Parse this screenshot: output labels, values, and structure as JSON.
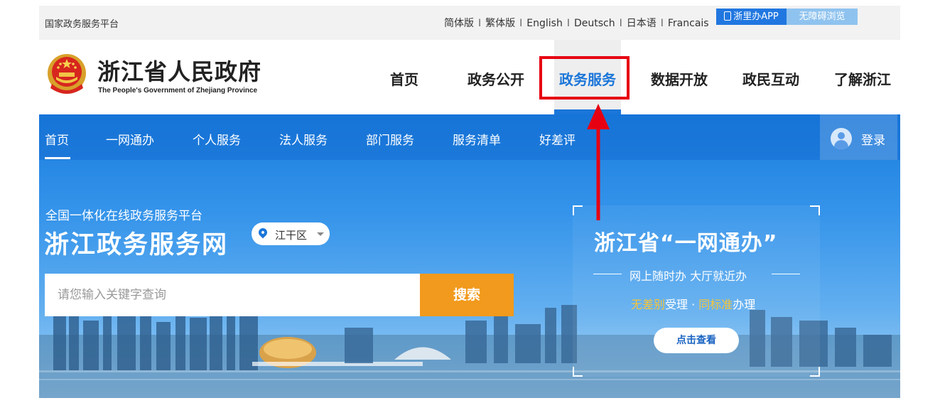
{
  "topbar": {
    "platform": "国家政务服务平台",
    "languages": [
      "简体版",
      "繁体版",
      "English",
      "Deutsch",
      "日本语",
      "Francais"
    ],
    "separator": "I",
    "app_button": "浙里办APP",
    "accessibility_button": "无障碍浏览"
  },
  "header": {
    "title": "浙江省人民政府",
    "subtitle": "The People's Government of Zhejiang Province",
    "nav": [
      "首页",
      "政务公开",
      "政务服务",
      "数据开放",
      "政民互动",
      "了解浙江"
    ],
    "active_nav": "政务服务"
  },
  "subnav": {
    "items": [
      "首页",
      "一网通办",
      "个人服务",
      "法人服务",
      "部门服务",
      "服务清单",
      "好差评"
    ],
    "login": "登录"
  },
  "banner": {
    "tagline": "全国一体化在线政务服务平台",
    "portal_name": "浙江政务服务网",
    "region": "江干区",
    "search_placeholder": "请您输入关键字查询",
    "search_button": "搜索"
  },
  "promo": {
    "title": "浙江省“一网通办”",
    "line1": "网上随时办 大厅就近办",
    "line2_hl1": "无差别",
    "line2_a": "受理 · ",
    "line2_hl2": "同标准",
    "line2_b": "办理",
    "button": "点击查看"
  },
  "colors": {
    "accent_blue": "#1b76d9",
    "search_orange": "#f19a1d",
    "annotation_red": "#e60012",
    "highlight_yellow": "#f7c536"
  }
}
